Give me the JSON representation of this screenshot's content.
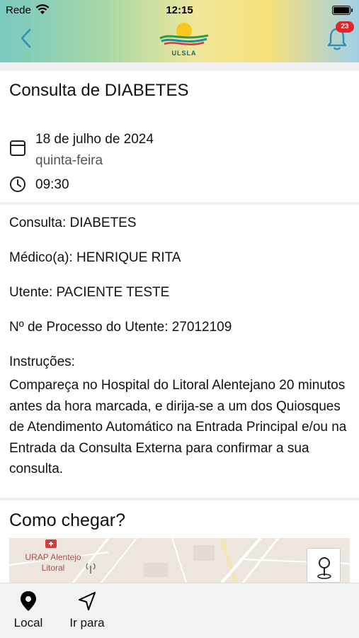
{
  "status_bar": {
    "carrier": "Rede",
    "time": "12:15"
  },
  "header": {
    "logo_text": "ULSLA",
    "notification_count": "23"
  },
  "appointment": {
    "title": "Consulta de DIABETES",
    "date": "18 de julho de 2024",
    "weekday": "quinta-feira",
    "time": "09:30"
  },
  "details": {
    "consulta": "Consulta: DIABETES",
    "medico": "Médico(a): HENRIQUE RITA",
    "utente": "Utente: PACIENTE TESTE",
    "processo": "Nº de Processo do Utente: 27012109",
    "instructions_label": "Instruções:",
    "instructions_text": "Compareça no Hospital do Litoral Alentejano 20 minutos antes da hora marcada, e dirija-se a um dos Quiosques de Atendimento Automático na Entrada Principal e/ou na Entrada da Consulta Externa para confirmar a sua consulta."
  },
  "directions": {
    "title": "Como chegar?",
    "map_label": "URAP Alentejo Litoral"
  },
  "bottom_bar": {
    "local_label": "Local",
    "go_label": "Ir para"
  }
}
